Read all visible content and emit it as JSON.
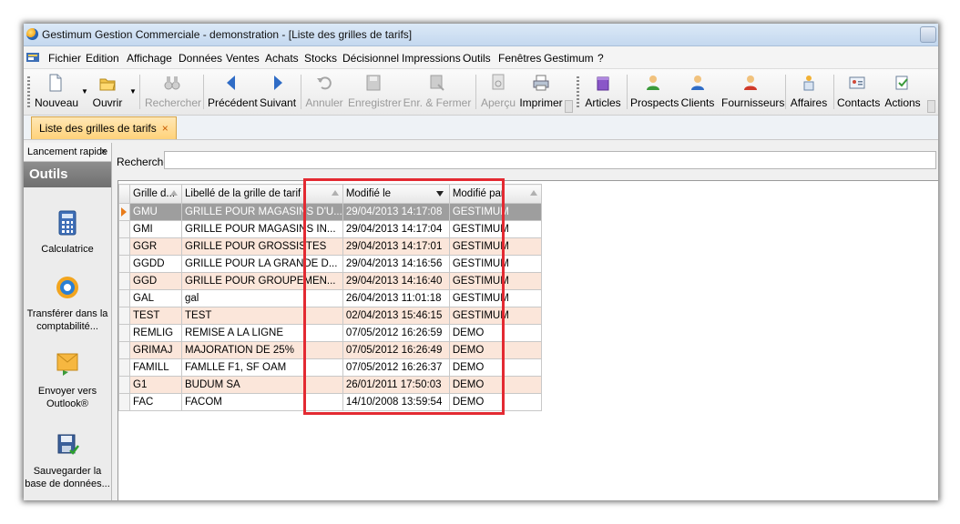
{
  "window": {
    "title": "Gestimum Gestion Commerciale - demonstration - [Liste des grilles de tarifs]"
  },
  "menu": [
    "Fichier",
    "Edition",
    "Affichage",
    "Données",
    "Ventes",
    "Achats",
    "Stocks",
    "Décisionnel",
    "Impressions",
    "Outils",
    "Fenêtres",
    "Gestimum",
    "?"
  ],
  "toolbar": {
    "nouveau": "Nouveau",
    "ouvrir": "Ouvrir",
    "rechercher": "Rechercher",
    "precedent": "Précédent",
    "suivant": "Suivant",
    "annuler": "Annuler",
    "enregistrer": "Enregistrer",
    "enr_fermer": "Enr. & Fermer",
    "apercu": "Aperçu",
    "imprimer": "Imprimer",
    "articles": "Articles",
    "prospects": "Prospects",
    "clients": "Clients",
    "fournisseurs": "Fournisseurs",
    "affaires": "Affaires",
    "contacts": "Contacts",
    "actions": "Actions"
  },
  "doc_tab": {
    "label": "Liste des grilles de tarifs",
    "close": "×"
  },
  "left_panel": {
    "header": "Lancement rapide",
    "close": "×",
    "section": "Outils",
    "items": [
      {
        "label": "Calculatrice",
        "icon": "calculator-icon"
      },
      {
        "label": "Transférer dans la comptabilité...",
        "icon": "transfer-icon"
      },
      {
        "label": "Envoyer vers Outlook®",
        "icon": "outlook-icon"
      },
      {
        "label": "Sauvegarder la base de données...",
        "icon": "save-database-icon"
      }
    ]
  },
  "search": {
    "label": "Rechercher",
    "value": ""
  },
  "grid": {
    "columns": [
      "Grille d...",
      "Libellé de la grille de tarif",
      "Modifié le",
      "Modifié par"
    ],
    "rows": [
      [
        "GMU",
        "GRILLE POUR MAGASINS D'U...",
        "29/04/2013 14:17:08",
        "GESTIMUM"
      ],
      [
        "GMI",
        "GRILLE POUR MAGASINS IN...",
        "29/04/2013 14:17:04",
        "GESTIMUM"
      ],
      [
        "GGR",
        "GRILLE POUR GROSSISTES",
        "29/04/2013 14:17:01",
        "GESTIMUM"
      ],
      [
        "GGDD",
        "GRILLE POUR LA GRANDE D...",
        "29/04/2013 14:16:56",
        "GESTIMUM"
      ],
      [
        "GGD",
        "GRILLE POUR GROUPEMEN...",
        "29/04/2013 14:16:40",
        "GESTIMUM"
      ],
      [
        "GAL",
        "gal",
        "26/04/2013 11:01:18",
        "GESTIMUM"
      ],
      [
        "TEST",
        "TEST",
        "02/04/2013 15:46:15",
        "GESTIMUM"
      ],
      [
        "REMLIG",
        "REMISE A LA LIGNE",
        "07/05/2012 16:26:59",
        "DEMO"
      ],
      [
        "GRIMAJ",
        "MAJORATION DE 25%",
        "07/05/2012 16:26:49",
        "DEMO"
      ],
      [
        "FAMILL",
        "FAMLLE F1, SF OAM",
        "07/05/2012 16:26:37",
        "DEMO"
      ],
      [
        "G1",
        "BUDUM SA",
        "26/01/2011 17:50:03",
        "DEMO"
      ],
      [
        "FAC",
        "FACOM",
        "14/10/2008 13:59:54",
        "DEMO"
      ]
    ]
  },
  "colors": {
    "highlight": "#e32a32",
    "selected_row": "#9e9e9e",
    "alt_row": "#fbe6da",
    "tab_orange": "#ffd27a"
  }
}
